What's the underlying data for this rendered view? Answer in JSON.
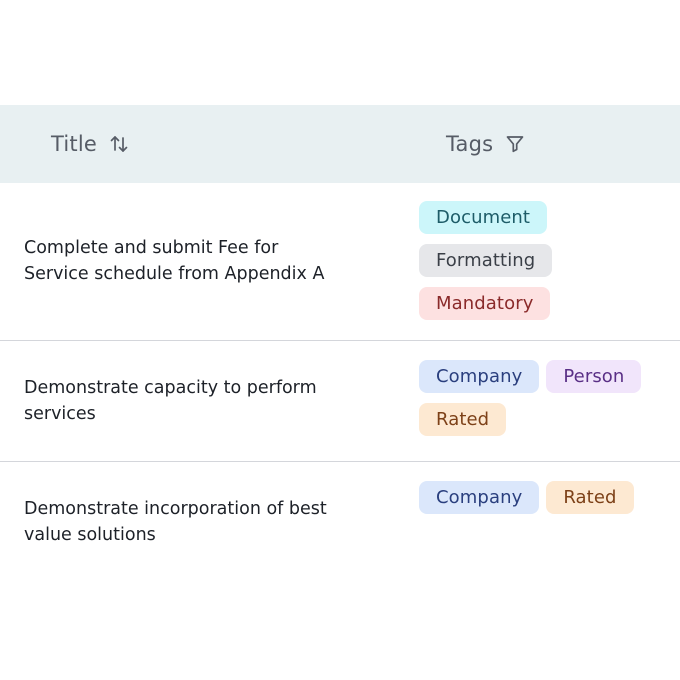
{
  "table": {
    "columns": {
      "title": {
        "label": "Title",
        "icon": "sort-arrows-icon"
      },
      "tags": {
        "label": "Tags",
        "icon": "filter-funnel-icon"
      }
    },
    "rows": [
      {
        "title_line1": "Complete and submit Fee for",
        "title_line2": "Service schedule from Appendix A",
        "tags": [
          "Document",
          "Formatting",
          "Mandatory"
        ]
      },
      {
        "title_line1": "Demonstrate capacity to perform",
        "title_line2": "services",
        "tags": [
          "Company",
          "Person",
          "Rated"
        ]
      },
      {
        "title_line1": "Demonstrate incorporation of best",
        "title_line2": "value solutions",
        "tags": [
          "Company",
          "Rated"
        ]
      }
    ]
  },
  "tag_colors": {
    "Document": {
      "bg": "#ccf6fa",
      "fg": "#1d5c68"
    },
    "Formatting": {
      "bg": "#e6e7ea",
      "fg": "#3a3f47"
    },
    "Mandatory": {
      "bg": "#fde1e1",
      "fg": "#8a2a2a"
    },
    "Company": {
      "bg": "#dbe7fb",
      "fg": "#2a3f7e"
    },
    "Person": {
      "bg": "#f1e5fb",
      "fg": "#5a2f86"
    },
    "Rated": {
      "bg": "#fde9d2",
      "fg": "#7d4118"
    }
  },
  "header_bg": "#e8f0f2"
}
